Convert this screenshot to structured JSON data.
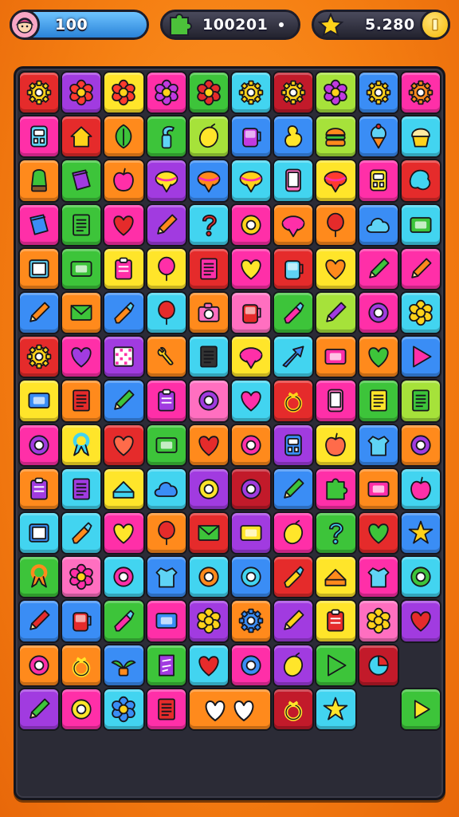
{
  "hud": {
    "lives": "100",
    "score": "100201",
    "coins": "5.280"
  },
  "palette": {
    "red": "#e52b2b",
    "purple": "#a13be0",
    "orange": "#ff8a1c",
    "yellow": "#ffe52a",
    "green": "#3dc43a",
    "cyan": "#42d4f0",
    "magenta": "#ff2fa8",
    "lime": "#a6e23a",
    "blue": "#3a8df5",
    "pink": "#ff6fc0",
    "darkred": "#c21a2a"
  },
  "board": {
    "rows": [
      [
        [
          "red",
          "gear",
          "#ffd21a"
        ],
        [
          "purple",
          "flower",
          "#ff3b2f"
        ],
        [
          "yellow",
          "flower",
          "#ff3b2f"
        ],
        [
          "magenta",
          "flower",
          "#c13ae0"
        ],
        [
          "green",
          "flower",
          "#e52b2b"
        ],
        [
          "cyan",
          "gear",
          "#ffd21a"
        ],
        [
          "darkred",
          "gear",
          "#ffd21a"
        ],
        [
          "lime",
          "flower",
          "#c13ae0"
        ],
        [
          "blue",
          "gear",
          "#ffd21a"
        ],
        [
          "magenta",
          "gear",
          "#ff8a1c"
        ]
      ],
      [
        [
          "magenta",
          "robot",
          "#5fd3f5"
        ],
        [
          "red",
          "house",
          "#ffd21a"
        ],
        [
          "orange",
          "leaf",
          "#3dc43a"
        ],
        [
          "green",
          "spray",
          "#5fd3f5"
        ],
        [
          "lime",
          "lemon",
          "#ffe52a"
        ],
        [
          "blue",
          "jar",
          "#c13ae0"
        ],
        [
          "blue",
          "duck",
          "#ffe52a"
        ],
        [
          "lime",
          "burger",
          "#ff8a1c"
        ],
        [
          "blue",
          "icecream",
          "#5fd3f5"
        ],
        [
          "cyan",
          "cupcake",
          "#ffd21a"
        ]
      ],
      [
        [
          "orange",
          "cactus",
          "#3dc43a"
        ],
        [
          "green",
          "book",
          "#a13be0"
        ],
        [
          "orange",
          "apple",
          "#ff2fa8"
        ],
        [
          "purple",
          "top",
          "#ffe52a"
        ],
        [
          "blue",
          "top",
          "#ff8a1c"
        ],
        [
          "cyan",
          "top",
          "#ffd21a"
        ],
        [
          "cyan",
          "phone",
          "#ff6fc0"
        ],
        [
          "yellow",
          "top",
          "#ff3b2f"
        ],
        [
          "magenta",
          "robot",
          "#ffe52a"
        ],
        [
          "red",
          "blob",
          "#42d4f0"
        ]
      ],
      [
        [
          "magenta",
          "book",
          "#3a8df5"
        ],
        [
          "green",
          "notepad",
          "#3dc43a"
        ],
        [
          "magenta",
          "heart",
          "#e52b2b"
        ],
        [
          "purple",
          "pencil",
          "#ff8a1c"
        ],
        [
          "cyan",
          "question",
          "#e52b2b"
        ],
        [
          "magenta",
          "ring",
          "#ffd21a"
        ],
        [
          "orange",
          "top",
          "#ff2fa8"
        ],
        [
          "orange",
          "balloon",
          "#e52b2b"
        ],
        [
          "blue",
          "cloud",
          "#5fd3f5"
        ],
        [
          "cyan",
          "card",
          "#3dc43a"
        ]
      ],
      [
        [
          "orange",
          "tablet",
          "#5fd3f5"
        ],
        [
          "green",
          "card",
          "#3dc43a"
        ],
        [
          "yellow",
          "clipboard",
          "#ff2fa8"
        ],
        [
          "yellow",
          "balloon",
          "#ff2fa8"
        ],
        [
          "red",
          "notepad",
          "#ff2fa8"
        ],
        [
          "magenta",
          "heart",
          "#ffe52a"
        ],
        [
          "red",
          "jar",
          "#5fd3f5"
        ],
        [
          "yellow",
          "heart",
          "#ff8a1c"
        ],
        [
          "magenta",
          "pencil",
          "#3dc43a"
        ],
        [
          "magenta",
          "pencil",
          "#ff8a1c"
        ]
      ],
      [
        [
          "blue",
          "pencil",
          "#ff8a1c"
        ],
        [
          "orange",
          "envelope",
          "#3dc43a"
        ],
        [
          "blue",
          "brush",
          "#ff8a1c"
        ],
        [
          "cyan",
          "balloon",
          "#e52b2b"
        ],
        [
          "orange",
          "camera",
          "#ff6fc0"
        ],
        [
          "pink",
          "jar",
          "#e52b2b"
        ],
        [
          "green",
          "brush",
          "#ff2fa8"
        ],
        [
          "lime",
          "pencil",
          "#a13be0"
        ],
        [
          "magenta",
          "ring",
          "#a13be0"
        ],
        [
          "cyan",
          "flower",
          "#ffd21a"
        ]
      ],
      [
        [
          "red",
          "gear",
          "#ffd21a"
        ],
        [
          "magenta",
          "heart",
          "#a13be0"
        ],
        [
          "purple",
          "grid",
          "#ff2fa8"
        ],
        [
          "orange",
          "wrench",
          "#ffd21a"
        ],
        [
          "cyan",
          "notepad",
          "#333"
        ],
        [
          "yellow",
          "top",
          "#ff2fa8"
        ],
        [
          "cyan",
          "arrow",
          "#3a8df5"
        ],
        [
          "orange",
          "card",
          "#ff2fa8"
        ],
        [
          "orange",
          "heart",
          "#3dc43a"
        ],
        [
          "blue",
          "triangle",
          "#ff2fa8"
        ]
      ],
      [
        [
          "yellow",
          "card",
          "#3a8df5"
        ],
        [
          "orange",
          "notepad",
          "#e52b2b"
        ],
        [
          "blue",
          "pencil",
          "#3dc43a"
        ],
        [
          "magenta",
          "clipboard",
          "#a13be0"
        ],
        [
          "pink",
          "ring",
          "#a13be0"
        ],
        [
          "cyan",
          "heart",
          "#ff2fa8"
        ],
        [
          "red",
          "bow",
          "#ffd21a"
        ],
        [
          "magenta",
          "phone",
          "#ff6fc0"
        ],
        [
          "green",
          "notepad",
          "#ffe52a"
        ],
        [
          "lime",
          "notepad",
          "#3dc43a"
        ]
      ],
      [
        [
          "magenta",
          "ring",
          "#a13be0"
        ],
        [
          "yellow",
          "ribbon",
          "#42d4f0"
        ],
        [
          "red",
          "heart",
          "#ff6b4a"
        ],
        [
          "green",
          "card",
          "#3dc43a"
        ],
        [
          "orange",
          "heart",
          "#e52b2b"
        ],
        [
          "orange",
          "ring",
          "#ff2fa8"
        ],
        [
          "purple",
          "robot",
          "#3a8df5"
        ],
        [
          "yellow",
          "apple",
          "#ff6b4a"
        ],
        [
          "blue",
          "shirt",
          "#5fd3f5"
        ],
        [
          "orange",
          "ring",
          "#a13be0"
        ]
      ],
      [
        [
          "orange",
          "clipboard",
          "#a13be0"
        ],
        [
          "cyan",
          "notepad",
          "#a13be0"
        ],
        [
          "yellow",
          "cake",
          "#42d4f0"
        ],
        [
          "cyan",
          "cloud",
          "#3a8df5"
        ],
        [
          "purple",
          "ring",
          "#ffe52a"
        ],
        [
          "darkred",
          "ring",
          "#a13be0"
        ],
        [
          "blue",
          "pencil",
          "#3dc43a"
        ],
        [
          "magenta",
          "puzzle",
          "#3dc43a"
        ],
        [
          "orange",
          "card",
          "#ff2fa8"
        ],
        [
          "cyan",
          "apple",
          "#ff2fa8"
        ]
      ],
      [
        [
          "cyan",
          "tablet",
          "#3a8df5"
        ],
        [
          "cyan",
          "brush",
          "#ff8a1c"
        ],
        [
          "magenta",
          "heart",
          "#ffe52a"
        ],
        [
          "orange",
          "balloon",
          "#e52b2b"
        ],
        [
          "red",
          "envelope",
          "#3dc43a"
        ],
        [
          "purple",
          "card",
          "#ffe52a"
        ],
        [
          "magenta",
          "lemon",
          "#ffe52a"
        ],
        [
          "green",
          "question",
          "#42d4f0"
        ],
        [
          "red",
          "heart",
          "#3dc43a"
        ],
        [
          "blue",
          "star",
          "#ffd21a"
        ]
      ],
      [
        [
          "green",
          "ribbon",
          "#ff8a1c"
        ],
        [
          "pink",
          "flower",
          "#ff2fa8"
        ],
        [
          "cyan",
          "ring",
          "#ff2fa8"
        ],
        [
          "blue",
          "shirt",
          "#5fd3f5"
        ],
        [
          "cyan",
          "ring",
          "#ff8a1c"
        ],
        [
          "blue",
          "ring",
          "#42d4f0"
        ],
        [
          "red",
          "brush",
          "#ffd21a"
        ],
        [
          "yellow",
          "cake",
          "#ff8a1c"
        ],
        [
          "magenta",
          "shirt",
          "#5fd3f5"
        ],
        [
          "cyan",
          "ring",
          "#3dc43a"
        ]
      ],
      [
        [
          "blue",
          "pencil",
          "#e52b2b"
        ],
        [
          "blue",
          "jar",
          "#e52b2b"
        ],
        [
          "green",
          "brush",
          "#ff2fa8"
        ],
        [
          "magenta",
          "card",
          "#3a8df5"
        ],
        [
          "purple",
          "flower",
          "#ffd21a"
        ],
        [
          "orange",
          "gear",
          "#3a8df5"
        ],
        [
          "purple",
          "pencil",
          "#ffd21a"
        ],
        [
          "yellow",
          "clipboard",
          "#e52b2b"
        ],
        [
          "pink",
          "flower",
          "#ffd21a"
        ],
        [
          "purple",
          "heart",
          "#e52b2b"
        ]
      ],
      [
        [
          "orange",
          "ring",
          "#ff2fa8"
        ],
        [
          "orange",
          "bow",
          "#ffe52a"
        ],
        [
          "blue",
          "plant",
          "#3dc43a"
        ],
        [
          "green",
          "note",
          "#a13be0"
        ],
        [
          "cyan",
          "heart",
          "#e52b2b"
        ],
        [
          "magenta",
          "ring",
          "#3a8df5"
        ],
        [
          "purple",
          "lemon",
          "#ffe52a"
        ],
        [
          "green",
          "triangle",
          "#3dc43a"
        ],
        [
          "darkred",
          "pie",
          "#42d4f0"
        ],
        null
      ],
      [
        [
          "purple",
          "pencil",
          "#3dc43a"
        ],
        [
          "magenta",
          "ring",
          "#ffe52a"
        ],
        [
          "cyan",
          "flower",
          "#3a8df5"
        ],
        [
          "magenta",
          "notepad",
          "#e52b2b"
        ],
        [
          "hint",
          "hearts",
          "#ffffff"
        ],
        null,
        [
          "darkred",
          "bow",
          "#ffe52a"
        ],
        [
          "cyan",
          "star",
          "#ffe52a"
        ],
        null,
        [
          "green",
          "play",
          "#ffe52a"
        ]
      ]
    ]
  }
}
